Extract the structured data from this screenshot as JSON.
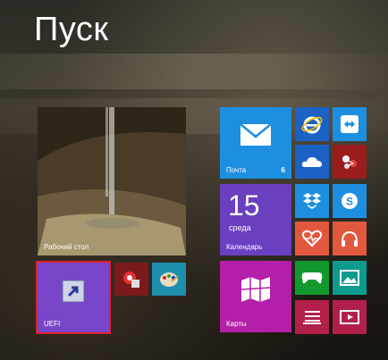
{
  "screen": {
    "title": "Пуск"
  },
  "tiles": {
    "desktop": {
      "label": "Рабочий стол"
    },
    "mail": {
      "label": "Почта",
      "count": "6"
    },
    "calendar": {
      "day": "15",
      "weekday": "среда",
      "label": "Календарь"
    },
    "uefi": {
      "label": "UEFI"
    },
    "maps": {
      "label": "Карты"
    }
  },
  "colors": {
    "mail": "#1e8fe0",
    "calendar": "#6a3fc0",
    "uefi": "#7a46c9",
    "maps": "#b31fa8",
    "selection": "#e0202a"
  }
}
